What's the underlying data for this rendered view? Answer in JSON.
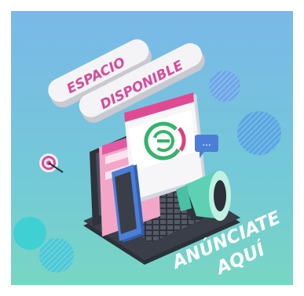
{
  "banner": {
    "pill_top": "ESPACIO",
    "pill_bottom": "DISPONIBLE",
    "cta_line1": "ANÚNCIATE",
    "cta_line2": "AQUÍ",
    "chat_bubble": "..."
  },
  "colors": {
    "bg_top": "#7ab6e6",
    "bg_bottom": "#74d3c9",
    "pill_text": "#d64a9c",
    "pill_body": "#f4f4f6",
    "laptop": "#3a3e48",
    "phone": "#4b7fd6",
    "megaphone": "#5ed1b4",
    "cta_text": "#ffffff",
    "logo_green": "#35b36a",
    "logo_red": "#e0407b"
  },
  "icons": [
    "target-icon",
    "chat-bubble-icon",
    "megaphone-icon",
    "brand-logo-icon",
    "phone-icon",
    "laptop-icon"
  ]
}
